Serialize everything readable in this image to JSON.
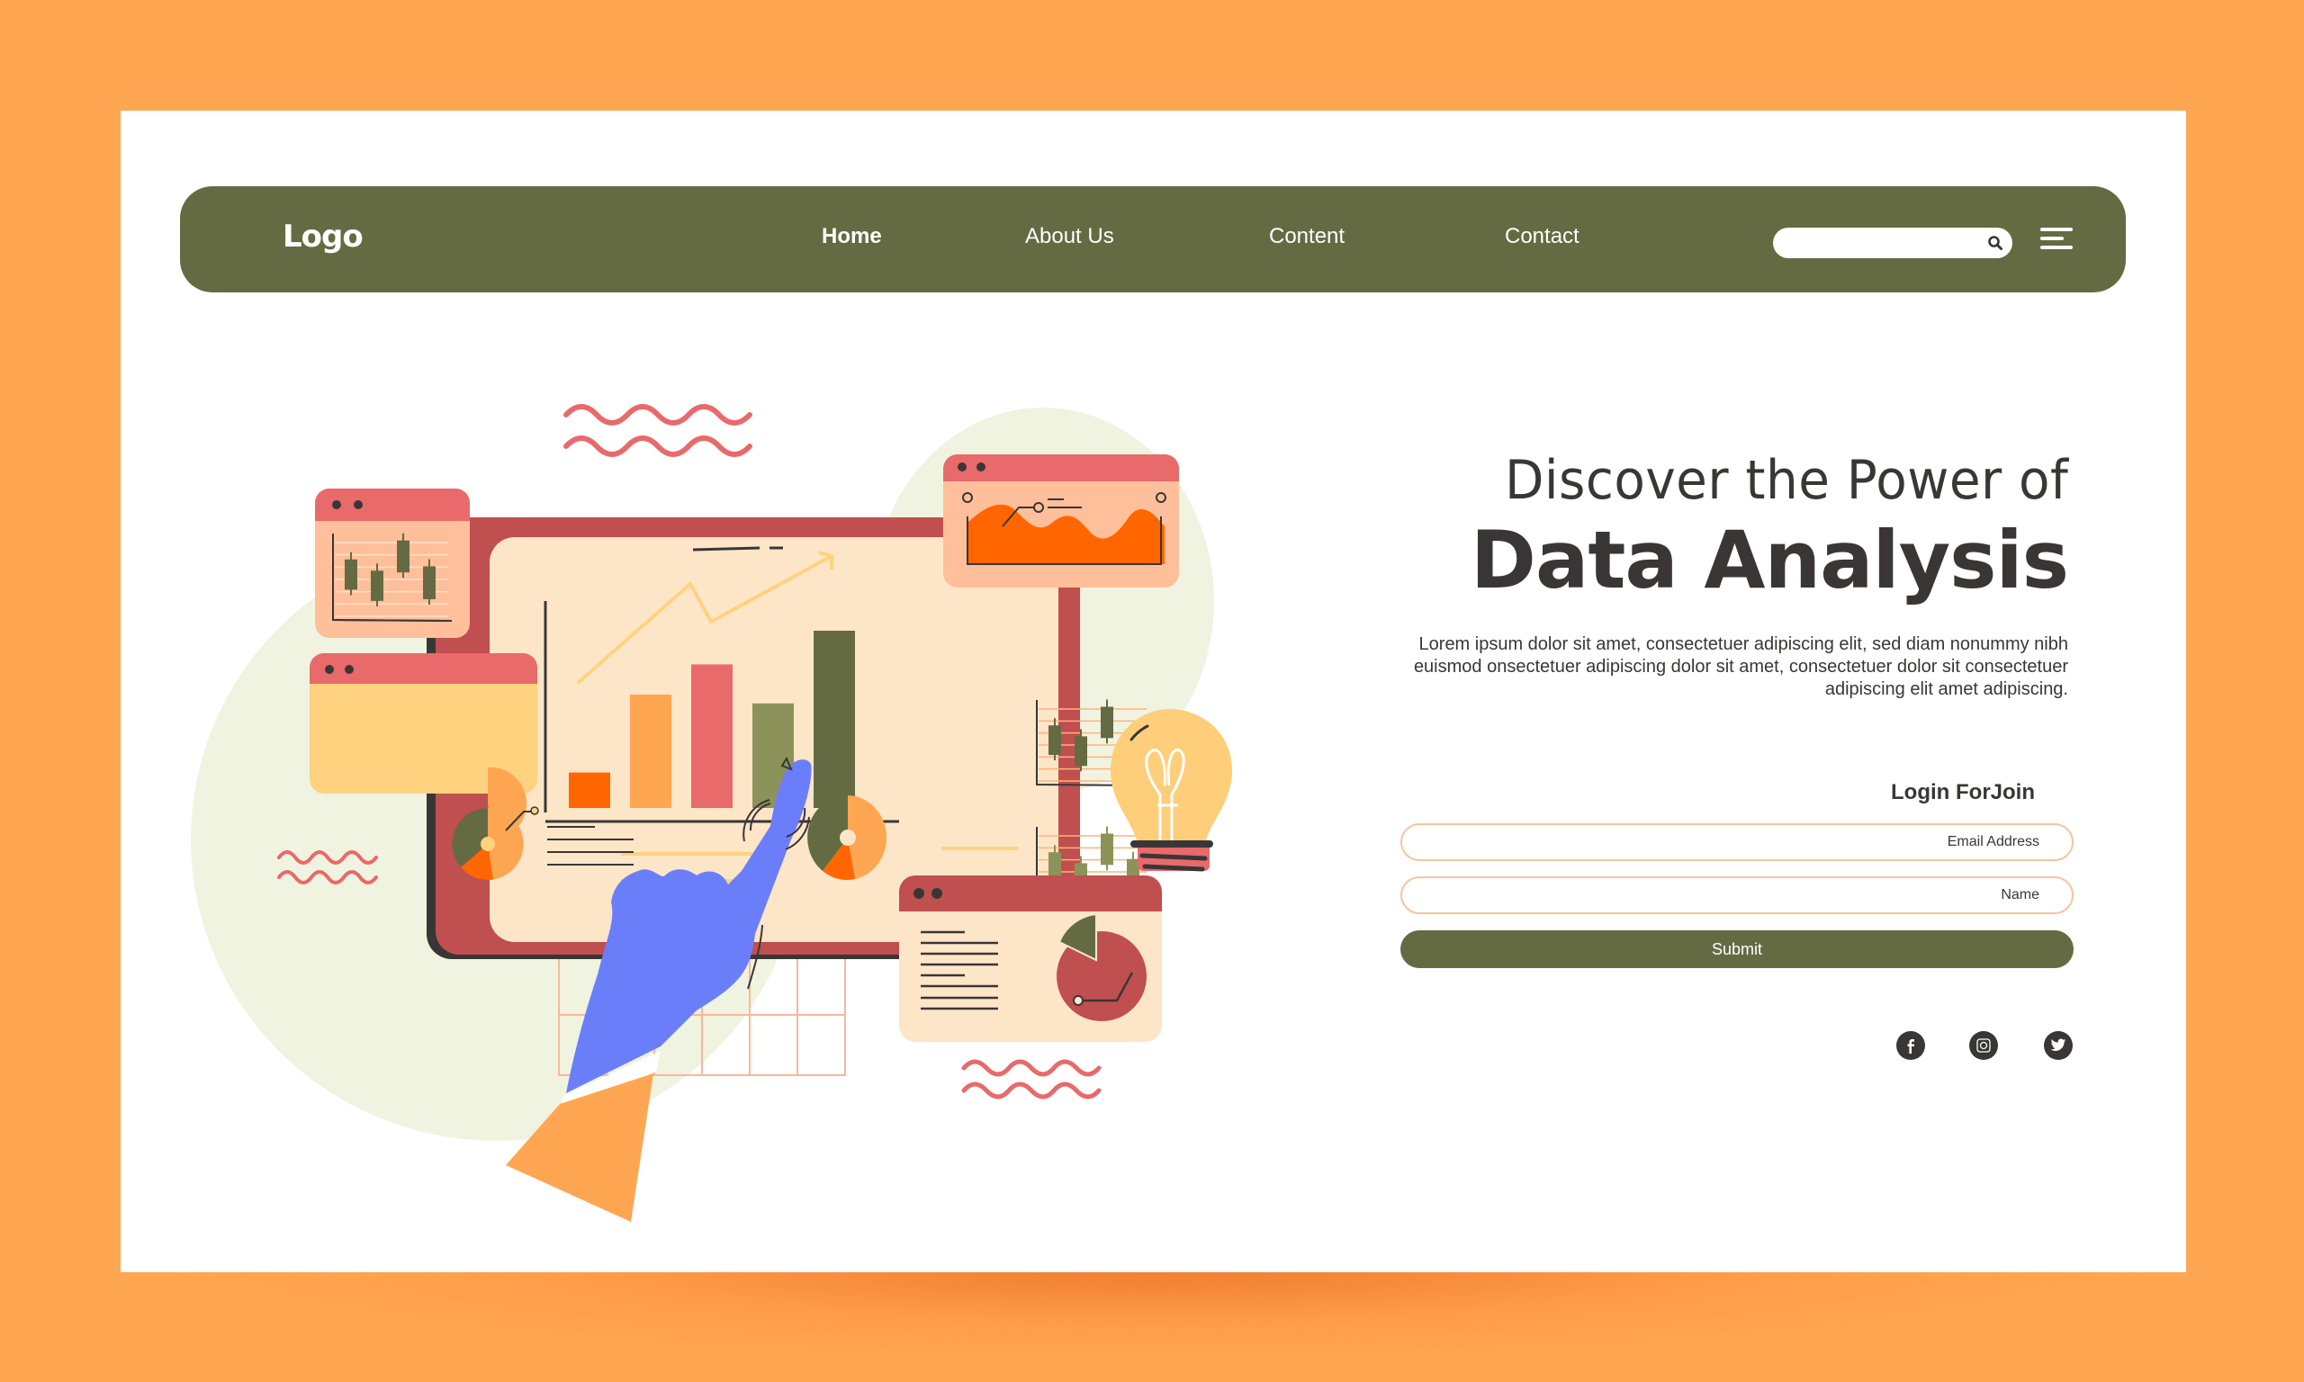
{
  "colors": {
    "page_background": "#FFA652",
    "card_background": "#FFFFFF",
    "navbar": "#646B42",
    "text_dark": "#3A3636",
    "field_border": "#F8C3A0",
    "submit": "#646B42"
  },
  "navbar": {
    "logo": "Logo",
    "links": [
      {
        "label": "Home",
        "active": true
      },
      {
        "label": "About Us",
        "active": false
      },
      {
        "label": "Content",
        "active": false
      },
      {
        "label": "Contact",
        "active": false
      }
    ],
    "search": {
      "value": "",
      "placeholder": "",
      "icon": "search-icon"
    },
    "menu_icon": "hamburger-menu-icon"
  },
  "hero": {
    "subtitle": "Discover the Power of",
    "title": "Data Analysis",
    "description": "Lorem ipsum dolor sit amet, consectetuer adipiscing elit, sed diam nonummy nibh euismod onsectetuer adipiscing dolor sit amet, consectetuer dolor sit consectetuer adipiscing elit amet adipiscing."
  },
  "login_form": {
    "title": "Login ForJoin",
    "email": {
      "value": "",
      "placeholder": "Email Address"
    },
    "name": {
      "value": "",
      "placeholder": "Name"
    },
    "submit_label": "Submit"
  },
  "social": [
    {
      "name": "facebook",
      "icon": "facebook-icon"
    },
    {
      "name": "instagram",
      "icon": "instagram-icon"
    },
    {
      "name": "twitter",
      "icon": "twitter-icon"
    }
  ],
  "illustration": {
    "description": "Hand pointing at a data analytics dashboard with bar chart, candlestick charts, pie charts, area chart and a light bulb",
    "bar_chart_relative_values": [
      0.2,
      0.64,
      0.81,
      0.59,
      1.0
    ]
  }
}
